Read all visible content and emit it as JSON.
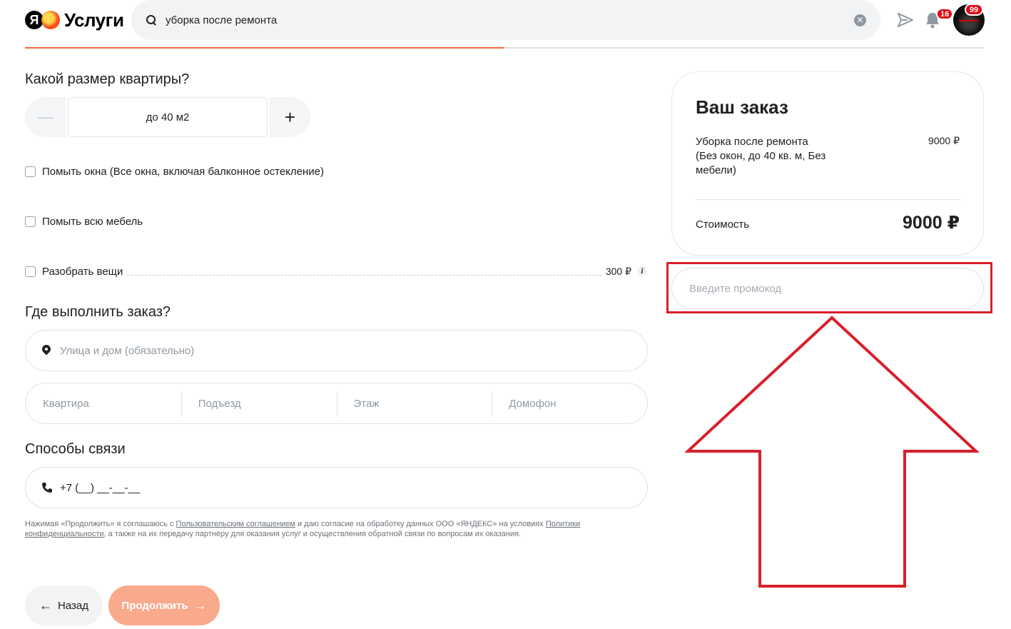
{
  "header": {
    "logo_letter": "Я",
    "logo_text": "Услуги",
    "search_value": "уборка после ремонта",
    "clear_symbol": "✕",
    "notifications_count": "16",
    "avatar_badge_count": "99",
    "progress_percent": 50
  },
  "form": {
    "size_question": "Какой размер квартиры?",
    "stepper": {
      "minus": "—",
      "value": "до 40 м2",
      "plus": "+"
    },
    "options": [
      {
        "label": "Помыть окна (Все окна, включая балконное остекление)",
        "price": ""
      },
      {
        "label": "Помыть всю мебель",
        "price": ""
      },
      {
        "label": "Разобрать вещи",
        "price": "300 ₽",
        "info": "i"
      }
    ],
    "where_question": "Где выполнить заказ?",
    "address_placeholder": "Улица и дом (обязательно)",
    "details": [
      "Квартира",
      "Подъезд",
      "Этаж",
      "Домофон"
    ],
    "contact_heading": "Способы связи",
    "phone_value": "+7 (__) __-__-__",
    "legal": {
      "part1": "Нажимая «Продолжить» я соглашаюсь с ",
      "link1": "Пользовательским соглашением",
      "part2": " и даю согласие на обработку данных ООО «ЯНДЕКС» на условиях ",
      "link2": "Политики конфиденциальности",
      "part3": ", а также на их передачу партнёру для оказания услуг и осуществления обратной связи по вопросам их оказания."
    },
    "back_label": "Назад",
    "back_arrow": "←",
    "next_label": "Продолжить",
    "next_arrow": "→"
  },
  "order": {
    "title": "Ваш заказ",
    "item_label": "Уборка после ремонта (Без окон, до 40 кв. м, Без мебели)",
    "item_price": "9000 ₽",
    "total_label": "Стоимость",
    "total_value": "9000 ₽",
    "promo_placeholder": "Введите промокод"
  },
  "colors": {
    "accent": "#f26b3a",
    "next_button": "#f9a98c",
    "annotation": "#d8202b",
    "badge": "#e30613"
  },
  "icons": {
    "search": "search-icon",
    "send": "send-icon",
    "bell": "bell-icon",
    "pin": "map-pin-icon",
    "phone": "phone-icon"
  }
}
